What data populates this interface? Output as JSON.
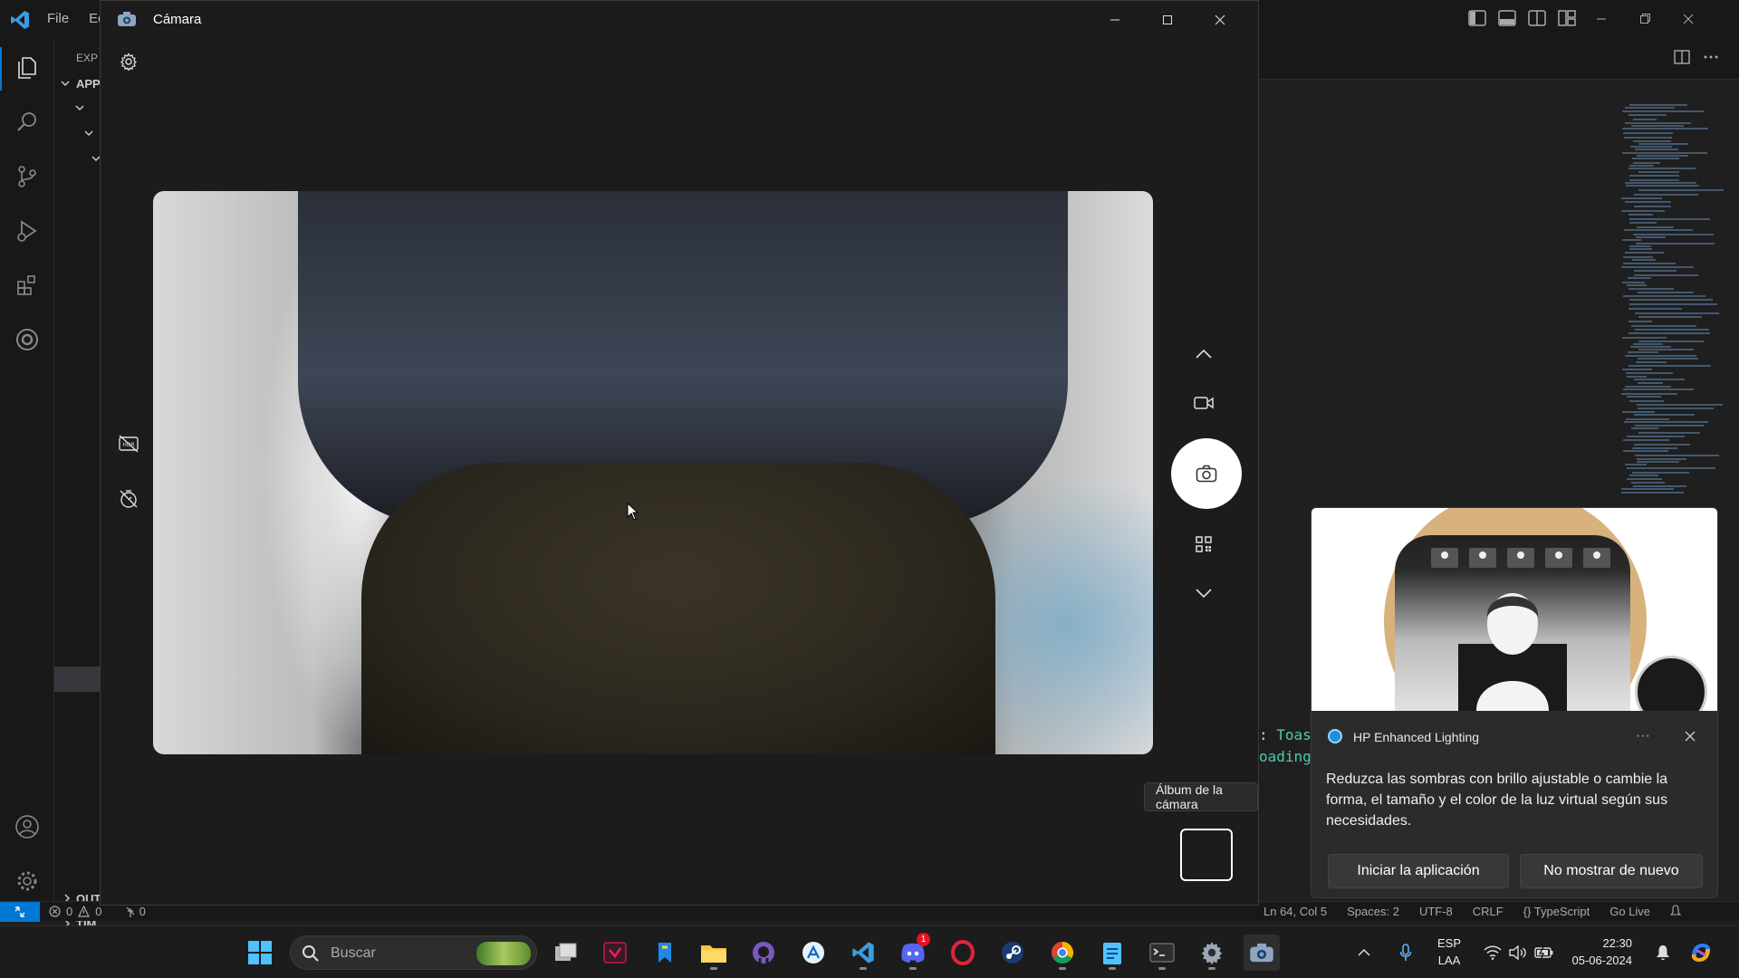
{
  "vscode": {
    "menu": [
      "File",
      "Ed"
    ],
    "sidebar": {
      "explorer_label": "EXP",
      "section_app": "APP",
      "outline_label": "OUT",
      "timeline_label": "TIM"
    },
    "code_snippet": [
      {
        "punc": ": ",
        "text": "Toas"
      },
      {
        "punc": "",
        "text": "oading"
      }
    ],
    "statusbar": {
      "errors": "0",
      "warnings": "0",
      "ports": "0",
      "items": [
        "Ln 64, Col 5",
        "Spaces: 2",
        "UTF-8",
        "CRLF",
        "{} TypeScript",
        "Go Live"
      ]
    }
  },
  "camera": {
    "title": "Cámara",
    "album_tooltip": "Álbum de la cámara",
    "icons": {
      "app": "camera-app-icon",
      "settings": "gear-icon",
      "hdr": "hdr-off-icon",
      "timer": "timer-off-icon",
      "mode_up": "chevron-up-icon",
      "video_mode": "video-camera-icon",
      "photo_capture": "camera-icon",
      "qr_mode": "qr-code-icon",
      "mode_down": "chevron-down-icon"
    }
  },
  "toast": {
    "app_name": "HP Enhanced Lighting",
    "body": "Reduzca las sombras con brillo ajustable o cambie la forma, el tamaño y el color de la luz virtual según sus necesidades.",
    "more": "···",
    "launch_button": "Iniciar la aplicación",
    "dismiss_button": "No mostrar de nuevo"
  },
  "taskbar": {
    "search_placeholder": "Buscar",
    "discord_badge": "1",
    "language_line1": "ESP",
    "language_line2": "LAA",
    "time": "22:30",
    "date": "05-06-2024",
    "accent": "#4cc2ff"
  }
}
